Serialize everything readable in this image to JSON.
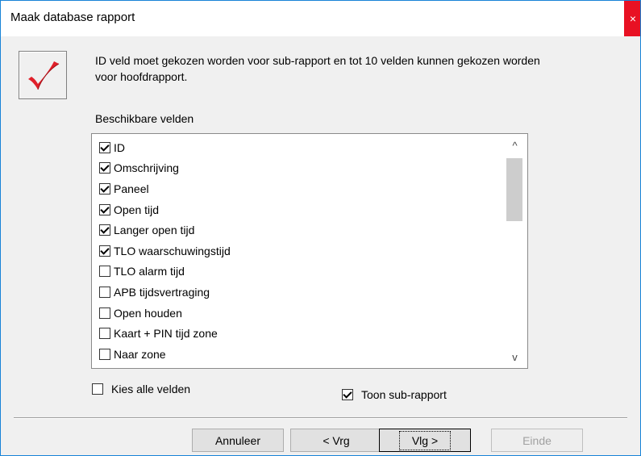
{
  "window": {
    "title": "Maak database rapport",
    "close_icon": "×"
  },
  "header": {
    "logo_icon": "red-checkmark-icon",
    "description": "ID veld moet gekozen worden voor sub-rapport en tot 10 velden kunnen gekozen worden voor hoofdrapport."
  },
  "fields": {
    "label": "Beschikbare velden",
    "items": [
      {
        "label": "ID",
        "checked": true
      },
      {
        "label": "Omschrijving",
        "checked": true
      },
      {
        "label": "Paneel",
        "checked": true
      },
      {
        "label": "Open tijd",
        "checked": true
      },
      {
        "label": "Langer open tijd",
        "checked": true
      },
      {
        "label": "TLO waarschuwingstijd",
        "checked": true
      },
      {
        "label": "TLO alarm tijd",
        "checked": false
      },
      {
        "label": "APB tijdsvertraging",
        "checked": false
      },
      {
        "label": "Open houden",
        "checked": false
      },
      {
        "label": "Kaart + PIN tijd zone",
        "checked": false
      },
      {
        "label": "Naar zone",
        "checked": false
      }
    ],
    "scroll_up": "^",
    "scroll_down": "v"
  },
  "options": {
    "select_all": {
      "label": "Kies alle velden",
      "checked": false
    },
    "show_sub": {
      "label": "Toon sub-rapport",
      "checked": true
    }
  },
  "buttons": {
    "cancel": "Annuleer",
    "back": "< Vrg",
    "next": "Vlg >",
    "finish": "Einde"
  }
}
